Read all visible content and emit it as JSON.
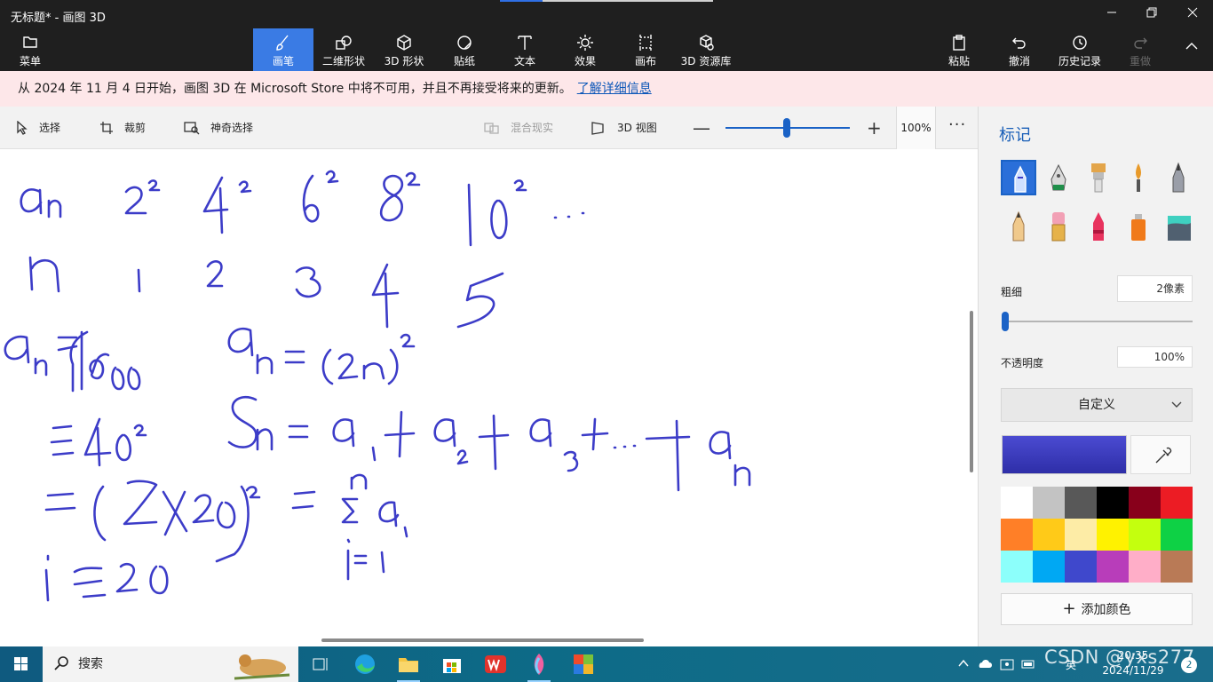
{
  "window": {
    "title": "无标题* - 画图 3D",
    "minimize_icon": "minimize-icon",
    "restore_icon": "restore-icon",
    "close_icon": "close-icon"
  },
  "ribbon": {
    "menu_label": "菜单",
    "tabs": [
      {
        "label": "画笔",
        "icon": "brush-icon",
        "active": true
      },
      {
        "label": "二维形状",
        "icon": "2d-shapes-icon"
      },
      {
        "label": "3D 形状",
        "icon": "3d-shapes-icon"
      },
      {
        "label": "贴纸",
        "icon": "sticker-icon"
      },
      {
        "label": "文本",
        "icon": "text-icon"
      },
      {
        "label": "效果",
        "icon": "effects-icon"
      },
      {
        "label": "画布",
        "icon": "canvas-icon"
      },
      {
        "label": "3D 资源库",
        "icon": "3d-library-icon"
      }
    ],
    "paste_label": "粘贴",
    "undo_label": "撤消",
    "history_label": "历史记录",
    "redo_label": "重做"
  },
  "notice": {
    "text": "从 2024 年 11 月 4 日开始，画图 3D 在 Microsoft Store 中将不可用，并且不再接受将来的更新。",
    "link": "了解详细信息"
  },
  "toolbar": {
    "select_label": "选择",
    "crop_label": "裁剪",
    "magic_select_label": "神奇选择",
    "mixed_reality_label": "混合现实",
    "view3d_label": "3D 视图",
    "zoom_minus": "—",
    "zoom_plus": "+",
    "zoom_value": "100%",
    "more": "···",
    "zoom_fraction": 0.47
  },
  "panel": {
    "title": "标记",
    "brushes": [
      {
        "name": "marker",
        "icon": "marker-icon",
        "selected": true
      },
      {
        "name": "calligraphy-pen",
        "icon": "calligraphy-pen-icon"
      },
      {
        "name": "oil-brush",
        "icon": "oil-brush-icon"
      },
      {
        "name": "watercolor",
        "icon": "watercolor-icon"
      },
      {
        "name": "pixel-pen",
        "icon": "pixel-pen-icon"
      },
      {
        "name": "pencil",
        "icon": "pencil-icon"
      },
      {
        "name": "eraser",
        "icon": "eraser-icon"
      },
      {
        "name": "crayon",
        "icon": "crayon-icon"
      },
      {
        "name": "spray-can",
        "icon": "spray-can-icon"
      },
      {
        "name": "fill",
        "icon": "fill-bucket-icon"
      }
    ],
    "thickness_label": "粗细",
    "thickness_value": "2像素",
    "opacity_label": "不透明度",
    "opacity_value": "100%",
    "preset_label": "自定义",
    "current_color": "#4b4bd1",
    "swatches": [
      "#ffffff",
      "#c3c3c3",
      "#585858",
      "#000000",
      "#88001b",
      "#ec1c24",
      "#ff7f27",
      "#ffca18",
      "#fdeca6",
      "#fff200",
      "#c4ff0e",
      "#0ed145",
      "#8cfffb",
      "#00a8f3",
      "#3f48cc",
      "#b83dba",
      "#ffaec8",
      "#b97a56"
    ],
    "add_color_label": "添加颜色"
  },
  "taskbar": {
    "search_label": "搜索",
    "time": "20:35",
    "date": "2024/11/29",
    "lang": "英",
    "notifications": "2",
    "watermark": "CSDN @yxs277",
    "icons": [
      "task-view-icon",
      "edge-icon",
      "file-explorer-icon",
      "store-icon",
      "wps-icon",
      "paint3d-icon",
      "app-icon"
    ]
  }
}
